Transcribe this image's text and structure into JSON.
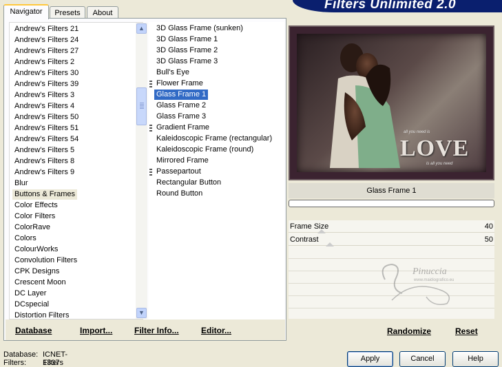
{
  "banner": {
    "title": "Filters Unlimited 2.0"
  },
  "tabs": [
    {
      "label": "Navigator",
      "active": true
    },
    {
      "label": "Presets",
      "active": false
    },
    {
      "label": "About",
      "active": false
    }
  ],
  "categories": [
    "Andrew's Filters 21",
    "Andrew's Filters 24",
    "Andrew's Filters 27",
    "Andrew's Filters 2",
    "Andrew's Filters 30",
    "Andrew's Filters 39",
    "Andrew's Filters 3",
    "Andrew's Filters 4",
    "Andrew's Filters 50",
    "Andrew's Filters 51",
    "Andrew's Filters 54",
    "Andrew's Filters 5",
    "Andrew's Filters 8",
    "Andrew's Filters 9",
    "Blur",
    "Buttons & Frames",
    "Color Effects",
    "Color Filters",
    "ColorRave",
    "Colors",
    "ColourWorks",
    "Convolution Filters",
    "CPK Designs",
    "Crescent Moon",
    "DC Layer",
    "DCspecial",
    "Distortion Filters"
  ],
  "selected_category": "Buttons & Frames",
  "filters": [
    {
      "label": "3D Glass Frame (sunken)",
      "group": false
    },
    {
      "label": "3D Glass Frame 1",
      "group": false
    },
    {
      "label": "3D Glass Frame 2",
      "group": false
    },
    {
      "label": "3D Glass Frame 3",
      "group": false
    },
    {
      "label": "Bull's Eye",
      "group": false
    },
    {
      "label": "Flower Frame",
      "group": true
    },
    {
      "label": "Glass Frame 1",
      "group": false
    },
    {
      "label": "Glass Frame 2",
      "group": false
    },
    {
      "label": "Glass Frame 3",
      "group": false
    },
    {
      "label": "Gradient Frame",
      "group": true
    },
    {
      "label": "Kaleidoscopic Frame (rectangular)",
      "group": false
    },
    {
      "label": "Kaleidoscopic Frame (round)",
      "group": false
    },
    {
      "label": "Mirrored Frame",
      "group": false
    },
    {
      "label": "Passepartout",
      "group": true
    },
    {
      "label": "Rectangular Button",
      "group": false
    },
    {
      "label": "Round Button",
      "group": false
    }
  ],
  "selected_filter": "Glass Frame 1",
  "bottom_links": {
    "database": "Database",
    "import": "Import...",
    "filter_info": "Filter Info...",
    "editor": "Editor..."
  },
  "preview": {
    "love_text": "LOVE",
    "love_small_top": "all you need is",
    "love_small_bottom": "is all you need"
  },
  "current_filter_name": "Glass Frame 1",
  "progress": 0,
  "sliders": [
    {
      "label": "Frame Size",
      "value": "40",
      "level": 0.16
    },
    {
      "label": "Contrast",
      "value": "50",
      "level": 0.2
    }
  ],
  "watermark": {
    "text": "Pinuccia",
    "subtext": "www.maidiografico.eu"
  },
  "right_buttons": {
    "randomize": "Randomize",
    "reset": "Reset"
  },
  "status": {
    "database_label": "Database:",
    "database_value": "ICNET-Filters",
    "filters_label": "Filters:",
    "filters_value": "1337"
  },
  "buttons": {
    "apply": "Apply",
    "cancel": "Cancel",
    "help": "Help"
  },
  "colors": {
    "banner": "#0a1f6e",
    "selection": "#316ac5",
    "window_bg": "#ece9d8"
  }
}
